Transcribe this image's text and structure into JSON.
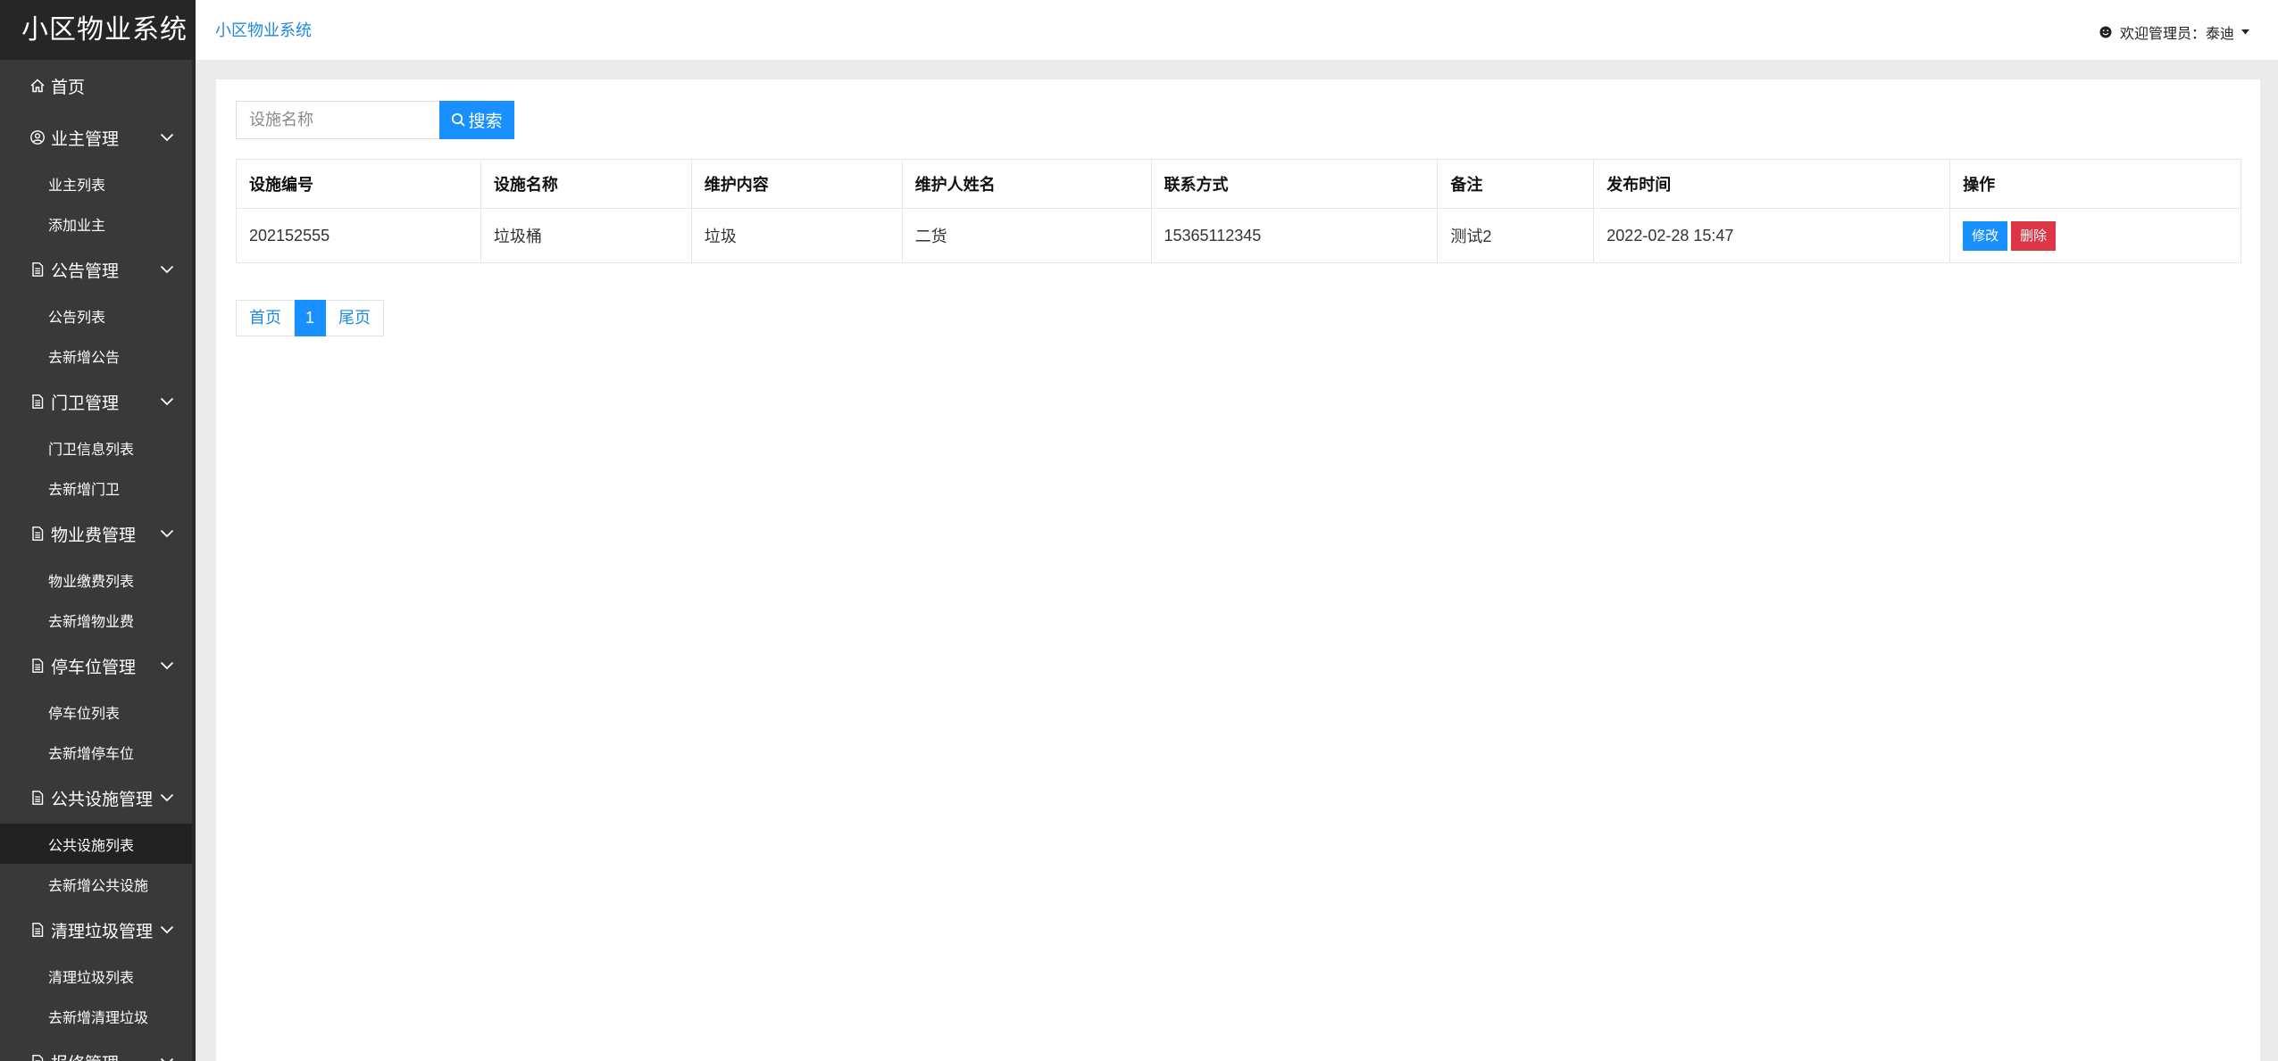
{
  "sidebar": {
    "brand": "小区物业系统",
    "home": "首页",
    "groups": [
      {
        "label": "业主管理",
        "items": [
          "业主列表",
          "添加业主"
        ]
      },
      {
        "label": "公告管理",
        "items": [
          "公告列表",
          "去新增公告"
        ]
      },
      {
        "label": "门卫管理",
        "items": [
          "门卫信息列表",
          "去新增门卫"
        ]
      },
      {
        "label": "物业费管理",
        "items": [
          "物业缴费列表",
          "去新增物业费"
        ]
      },
      {
        "label": "停车位管理",
        "items": [
          "停车位列表",
          "去新增停车位"
        ]
      },
      {
        "label": "公共设施管理",
        "items": [
          "公共设施列表",
          "去新增公共设施"
        ]
      },
      {
        "label": "清理垃圾管理",
        "items": [
          "清理垃圾列表",
          "去新增清理垃圾"
        ]
      },
      {
        "label": "报修管理",
        "items": []
      }
    ],
    "active_item": "公共设施列表"
  },
  "header": {
    "breadcrumb": "小区物业系统",
    "welcome": "欢迎管理员：泰迪"
  },
  "search": {
    "placeholder": "设施名称",
    "button_label": "搜索"
  },
  "table": {
    "columns": [
      "设施编号",
      "设施名称",
      "维护内容",
      "维护人姓名",
      "联系方式",
      "备注",
      "发布时间",
      "操作"
    ],
    "rows": [
      {
        "id": "202152555",
        "name": "垃圾桶",
        "content": "垃圾",
        "maintainer": "二货",
        "phone": "15365112345",
        "remark": "测试2",
        "time": "2022-02-28 15:47",
        "edit_label": "修改",
        "delete_label": "删除"
      }
    ]
  },
  "pagination": {
    "first": "首页",
    "current": "1",
    "last": "尾页"
  },
  "colors": {
    "sidebar_bg": "#393939",
    "brand_bg": "#262626",
    "primary": "#1890ff",
    "danger": "#dc3545",
    "link": "#1e88e5"
  }
}
